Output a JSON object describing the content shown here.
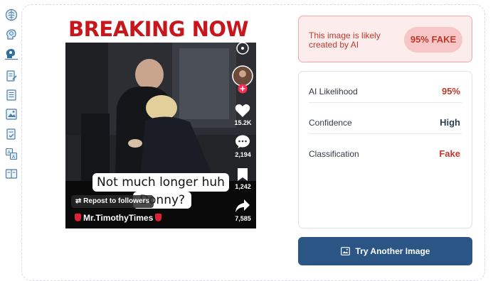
{
  "sidebar": {
    "icons": [
      "brain-icon",
      "brain-profile-icon",
      "brain-scan-icon",
      "document-edit-icon",
      "document-list-icon",
      "image-document-icon",
      "document-check-icon",
      "translate-icon",
      "reader-icon"
    ]
  },
  "preview": {
    "banner": "BREAKING NOW",
    "caption_line1": "Not much longer huh",
    "caption_line2": "Donny?",
    "repost_label": "Repost to followers",
    "author": "Mr.TimothyTimes",
    "likes": "15.2K",
    "comments": "2,194",
    "saves": "1,242",
    "shares": "7,585"
  },
  "result": {
    "message": "This image is likely created by AI",
    "badge": "95% FAKE"
  },
  "stats": [
    {
      "label": "AI Likelihood",
      "value": "95%",
      "color": "#c0392b"
    },
    {
      "label": "Confidence",
      "value": "High",
      "color": "#2c3e50"
    },
    {
      "label": "Classification",
      "value": "Fake",
      "color": "#c0392b"
    }
  ],
  "actions": {
    "try_another": "Try Another Image"
  },
  "colors": {
    "accent": "#2b5584",
    "danger": "#c0392b",
    "danger_bg": "#fdecec"
  }
}
